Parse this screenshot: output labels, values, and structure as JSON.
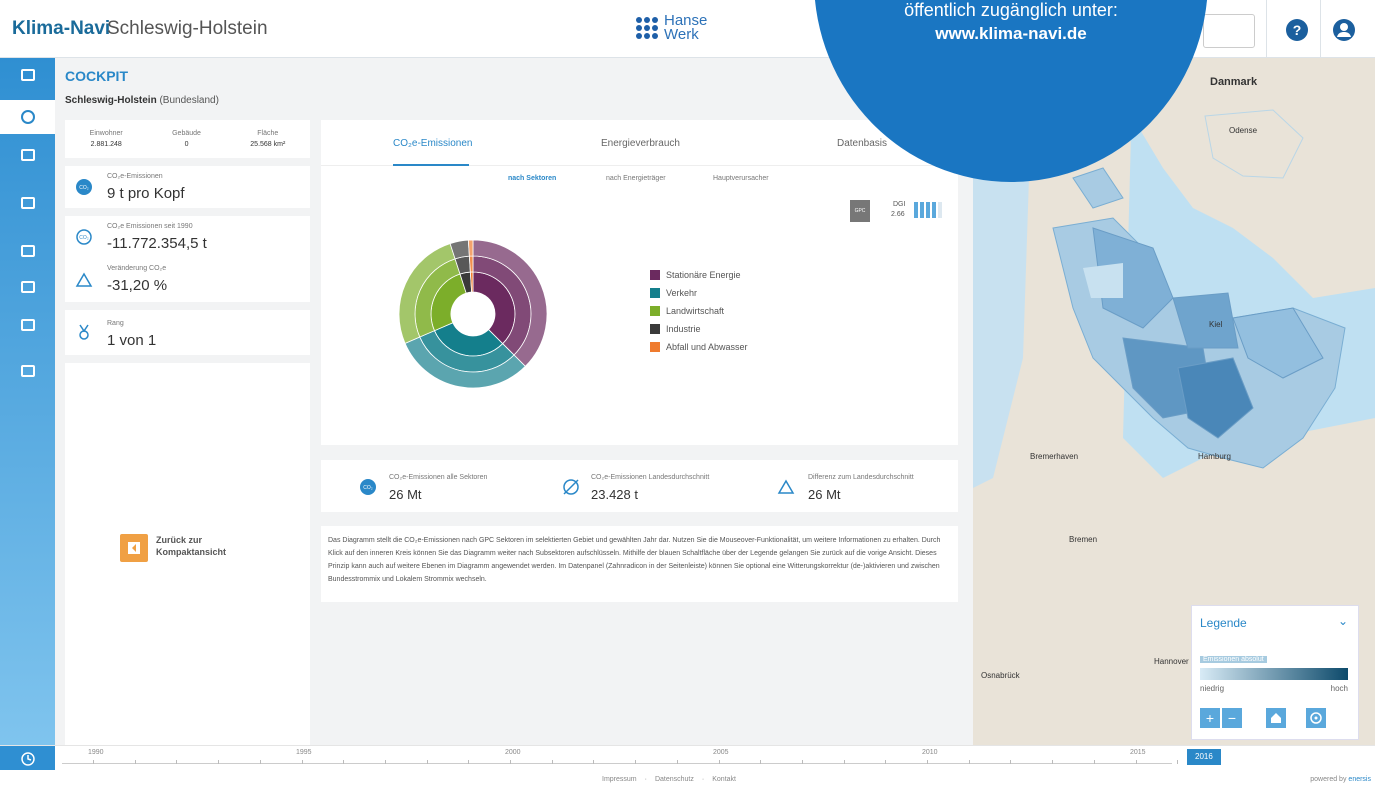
{
  "header": {
    "brand": "Klima-Navi",
    "region": "Schleswig-Holstein",
    "logo_line1": "Hanse",
    "logo_line2": "Werk",
    "help_label": "?"
  },
  "promo": {
    "line1": "öffentlich zugänglich unter:",
    "line2": "www.klima-navi.de"
  },
  "sidebar": {
    "items": [
      "profile-icon",
      "compass-icon",
      "map-icon",
      "settings-icon",
      "calculator-icon",
      "list-edit-icon",
      "chart-icon",
      "document-icon"
    ],
    "active_index": 1
  },
  "cockpit": {
    "title": "COCKPIT",
    "region_name": "Schleswig-Holstein",
    "region_type": "(Bundesland)",
    "stats": [
      {
        "label": "Einwohner",
        "value": "2.881.248"
      },
      {
        "label": "Gebäude",
        "value": "0"
      },
      {
        "label": "Fläche",
        "value": "25.568 km²"
      }
    ],
    "kpis": {
      "emissions_label": "CO₂e-Emissionen",
      "emissions_value": "9 t pro Kopf",
      "since_label": "CO₂e Emissionen seit 1990",
      "since_value": "-11.772.354,5 t",
      "change_label": "Veränderung CO₂e",
      "change_value": "-31,20 %",
      "rank_label": "Rang",
      "rank_value": "1 von 1"
    },
    "back_label": "Zurück zur Kompaktansicht"
  },
  "tabs": [
    "CO₂e-Emissionen",
    "Energieverbrauch",
    "Datenbasis"
  ],
  "active_tab": 0,
  "subtabs": [
    "nach Sektoren",
    "nach Energieträger",
    "Hauptverursacher"
  ],
  "active_subtab": 0,
  "quality": {
    "gpc_label": "GPC",
    "dgi_label": "DGI",
    "dgi_value": "2.66",
    "dgi_level": 2.66
  },
  "chart_data": {
    "type": "sunburst",
    "legend": [
      {
        "name": "Stationäre Energie",
        "color": "#6b2a5f"
      },
      {
        "name": "Verkehr",
        "color": "#147f8c"
      },
      {
        "name": "Landwirtschaft",
        "color": "#7cae2a"
      },
      {
        "name": "Industrie",
        "color": "#3a3a3a"
      },
      {
        "name": "Abfall und Abwasser",
        "color": "#ef7b2e"
      }
    ],
    "sectors": [
      {
        "name": "Stationäre Energie",
        "share": 0.375,
        "color": "#6b2a5f"
      },
      {
        "name": "Verkehr",
        "share": 0.31,
        "color": "#147f8c"
      },
      {
        "name": "Landwirtschaft",
        "share": 0.265,
        "color": "#7cae2a"
      },
      {
        "name": "Industrie",
        "share": 0.04,
        "color": "#3a3a3a"
      },
      {
        "name": "Abfall und Abwasser",
        "share": 0.01,
        "color": "#ef7b2e"
      }
    ]
  },
  "summary": [
    {
      "label": "CO₂e-Emissionen alle Sektoren",
      "value": "26 Mt",
      "icon": "co2-cloud-icon"
    },
    {
      "label": "CO₂e-Emissionen Landesdurchschnitt",
      "value": "23.428 t",
      "icon": "average-icon"
    },
    {
      "label": "Differenz zum Landesdurchschnitt",
      "value": "26 Mt",
      "icon": "delta-icon"
    }
  ],
  "description": "Das Diagramm stellt die CO₂e-Emissionen nach GPC Sektoren im selektierten Gebiet und gewählten Jahr dar. Nutzen Sie die Mouseover-Funktionalität, um weitere Informationen zu erhalten. Durch Klick auf den inneren Kreis können Sie das Diagramm weiter nach Subsektoren aufschlüsseln. Mithilfe der blauen Schaltfläche über der Legende gelangen Sie zurück auf die vorige Ansicht. Dieses Prinzip kann auch auf weitere Ebenen im Diagramm angewendet werden. Im Datenpanel (Zahnradicon in der Seitenleiste) können Sie optional eine Witterungskorrektur (de-)aktivieren und zwischen Bundesstrommix und Lokalem Strommix wechseln.",
  "map": {
    "cities": [
      "Danmark",
      "Odense",
      "Kiel",
      "Bremerhaven",
      "Hamburg",
      "Bremen",
      "Hannover",
      "Osnabrück"
    ],
    "legend_title": "Legende",
    "legend_subtitle": "Emissionen absolut",
    "legend_low": "niedrig",
    "legend_high": "hoch",
    "colors": {
      "low": "#d8ebf6",
      "high": "#0d4a6b"
    }
  },
  "timeline": {
    "years": [
      "1990",
      "1995",
      "2000",
      "2005",
      "2010",
      "2015"
    ],
    "selected": "2016"
  },
  "footer": {
    "links": [
      "Impressum",
      "Datenschutz",
      "Kontakt"
    ],
    "powered_prefix": "powered by",
    "powered_brand": "enersis"
  }
}
